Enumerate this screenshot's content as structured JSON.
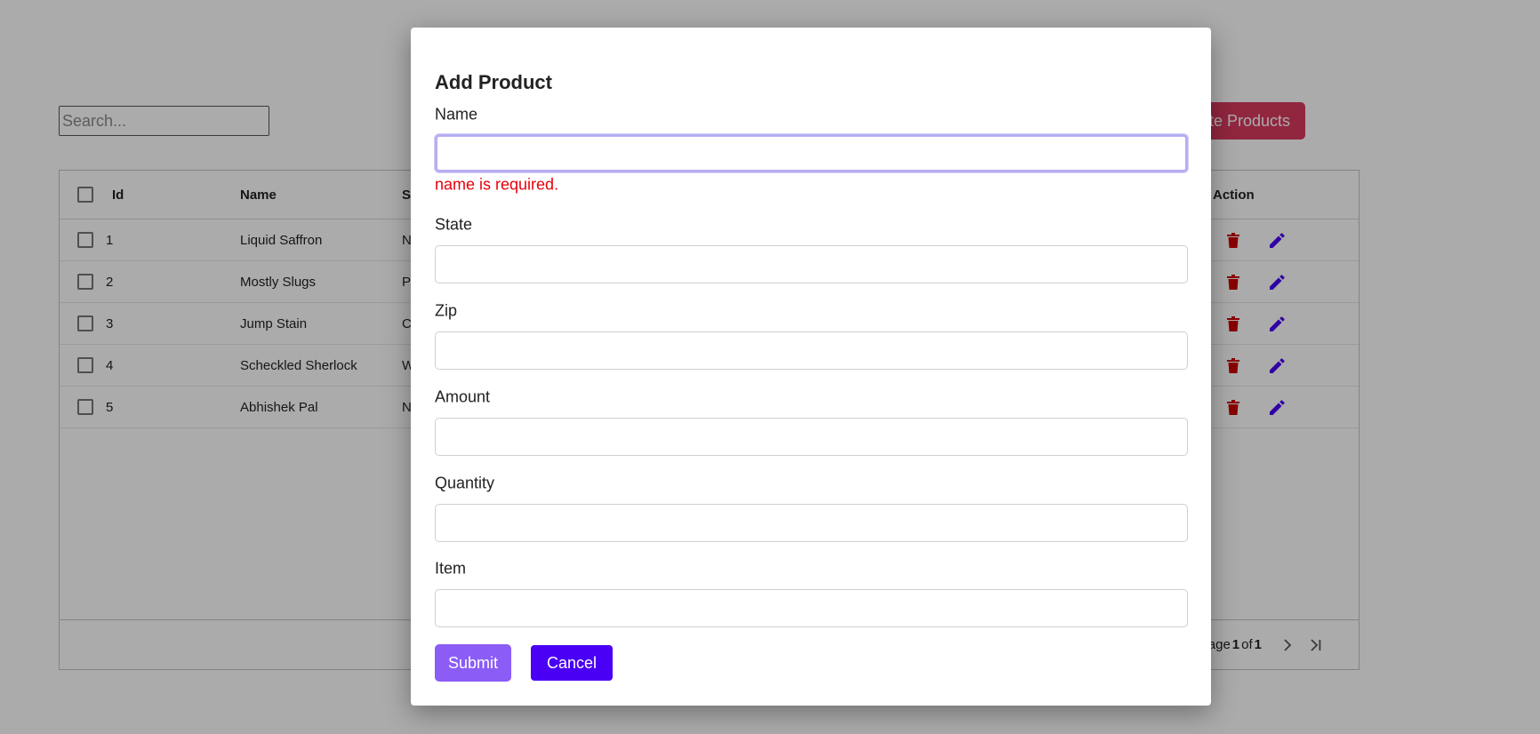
{
  "toolbar": {
    "search_placeholder": "Search...",
    "delete_label": "Delete Products"
  },
  "table": {
    "columns": {
      "id": "Id",
      "name": "Name",
      "state": "State",
      "action": "Action"
    },
    "rows": [
      {
        "id": "1",
        "name": "Liquid Saffron",
        "state": "N"
      },
      {
        "id": "2",
        "name": "Mostly Slugs",
        "state": "P"
      },
      {
        "id": "3",
        "name": "Jump Stain",
        "state": "C"
      },
      {
        "id": "4",
        "name": "Scheckled Sherlock",
        "state": "W"
      },
      {
        "id": "5",
        "name": "Abhishek Pal",
        "state": "N"
      }
    ],
    "pagination": {
      "page_word": "Page",
      "current": "1",
      "of_word": "of",
      "total": "1"
    },
    "icons": {
      "delete": "trash-icon",
      "edit": "pencil-icon",
      "next": "chevron-right-icon",
      "last": "last-page-icon"
    }
  },
  "modal": {
    "title": "Add Product",
    "fields": [
      {
        "label": "Name",
        "value": "",
        "error": "name is required."
      },
      {
        "label": "State",
        "value": ""
      },
      {
        "label": "Zip",
        "value": ""
      },
      {
        "label": "Amount",
        "value": ""
      },
      {
        "label": "Quantity",
        "value": ""
      },
      {
        "label": "Item",
        "value": ""
      }
    ],
    "submit_label": "Submit",
    "cancel_label": "Cancel"
  },
  "colors": {
    "delete_button": "#d9395f",
    "submit_button": "#8b5cf6",
    "cancel_button": "#4a00f5",
    "error": "#e8000b",
    "trash_icon": "#cc0000",
    "pencil_icon": "#4a00f5"
  }
}
